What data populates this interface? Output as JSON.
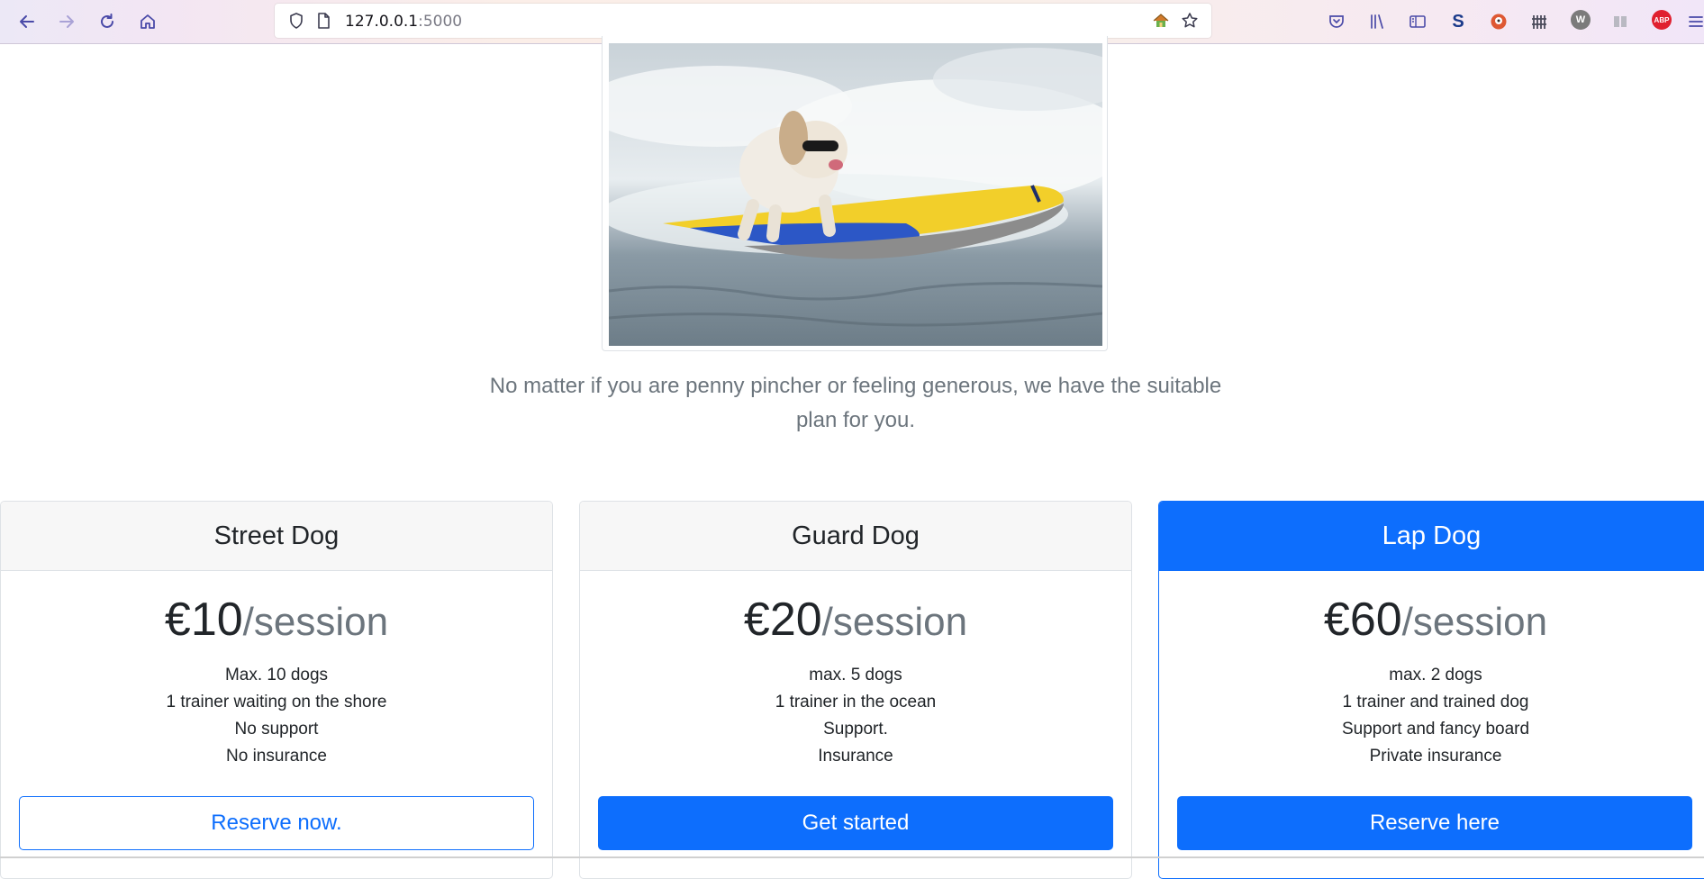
{
  "browser": {
    "url_host": "127.0.0.1",
    "url_port": ":5000",
    "extensions": {
      "s_label": "S",
      "w_label": "W",
      "abp_label": "ABP"
    }
  },
  "page": {
    "hero_alt": "Dog surfing on a surfboard",
    "lead": "No matter if you are penny pincher or feeling generous, we have the suitable plan for you.",
    "plans": [
      {
        "name": "Street Dog",
        "price": "€10",
        "period": "/session",
        "features": [
          "Max. 10 dogs",
          "1 trainer waiting on the shore",
          "No support",
          "No insurance"
        ],
        "button": "Reserve now."
      },
      {
        "name": "Guard Dog",
        "price": "€20",
        "period": "/session",
        "features": [
          "max. 5 dogs",
          "1 trainer in the ocean",
          "Support.",
          "Insurance"
        ],
        "button": "Get started"
      },
      {
        "name": "Lap Dog",
        "price": "€60",
        "period": "/session",
        "features": [
          "max. 2 dogs",
          "1 trainer and trained dog",
          "Support and fancy board",
          "Private insurance"
        ],
        "button": "Reserve here"
      }
    ]
  },
  "colors": {
    "primary": "#0d6efd",
    "muted": "#6c757d"
  }
}
